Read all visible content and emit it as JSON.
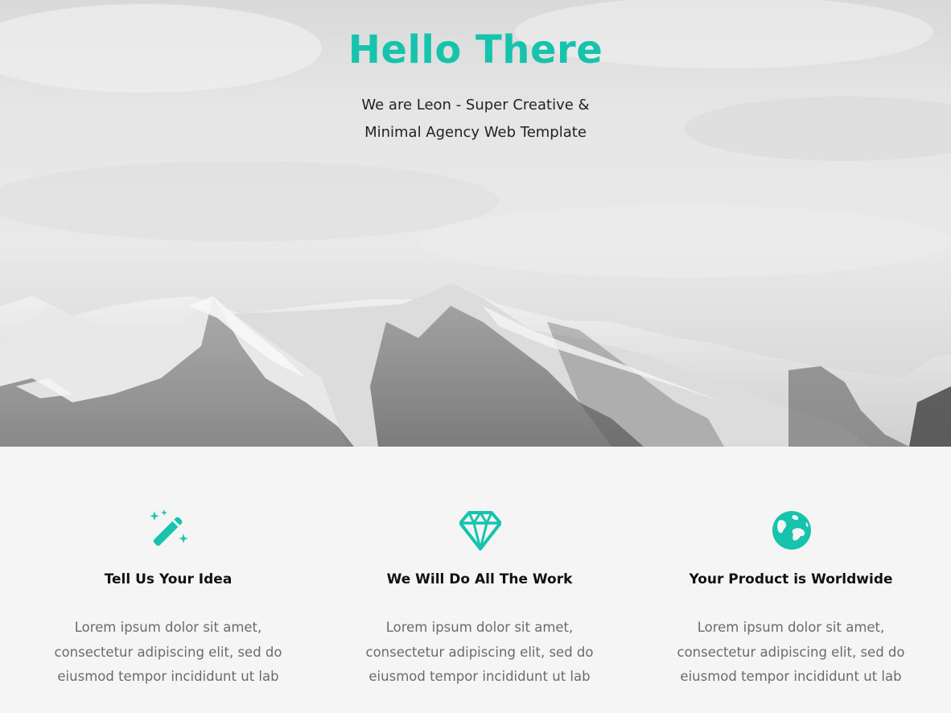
{
  "hero": {
    "title": "Hello There",
    "subtitle_line1": "We are Leon - Super Creative &",
    "subtitle_line2": "Minimal Agency Web Template",
    "accent_color": "#16c4ad",
    "background_image": "snowy-mountains-image"
  },
  "features": [
    {
      "icon": "magic-wand-icon",
      "title": "Tell Us Your Idea",
      "text_line1": "Lorem ipsum dolor sit amet,",
      "text_line2": "consectetur adipiscing elit, sed do",
      "text_line3": "eiusmod tempor incididunt ut lab"
    },
    {
      "icon": "diamond-icon",
      "title": "We Will Do All The Work",
      "text_line1": "Lorem ipsum dolor sit amet,",
      "text_line2": "consectetur adipiscing elit, sed do",
      "text_line3": "eiusmod tempor incididunt ut lab"
    },
    {
      "icon": "globe-icon",
      "title": "Your Product is Worldwide",
      "text_line1": "Lorem ipsum dolor sit amet,",
      "text_line2": "consectetur adipiscing elit, sed do",
      "text_line3": "eiusmod tempor incididunt ut lab"
    }
  ]
}
